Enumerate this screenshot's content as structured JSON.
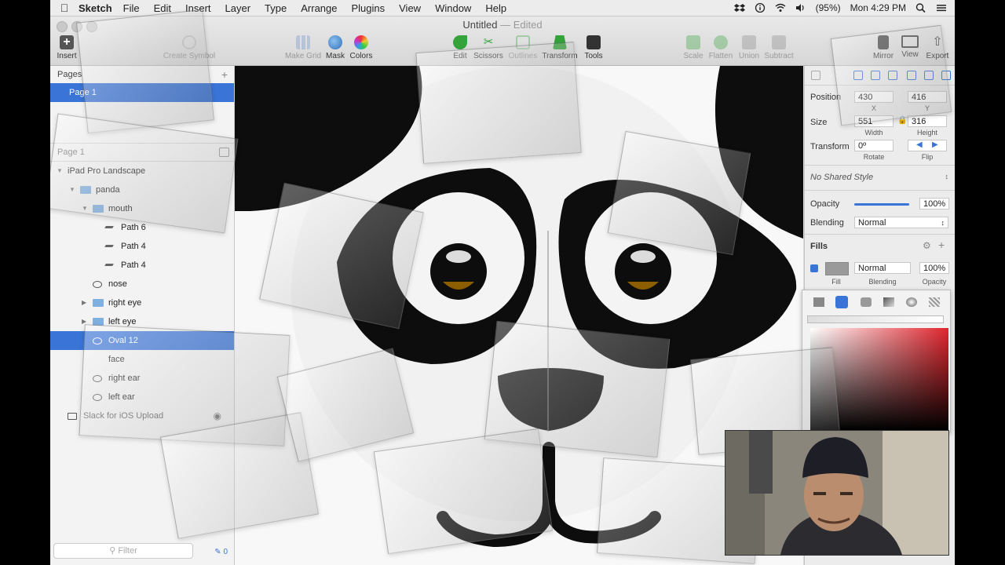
{
  "menubar": {
    "app_name": "Sketch",
    "menus": [
      "File",
      "Edit",
      "Insert",
      "Layer",
      "Type",
      "Arrange",
      "Plugins",
      "View",
      "Window",
      "Help"
    ],
    "battery": "(95%)",
    "clock": "Mon 4:29 PM"
  },
  "toolbar": {
    "document_title": "Untitled",
    "document_status": "— Edited",
    "buttons": [
      {
        "label": "Insert",
        "icon": "plus-icon",
        "color": "#555555"
      },
      {
        "label": "Create Symbol",
        "icon": "symbol-icon",
        "color": "#aaaaaa"
      },
      {
        "label": "Make Grid",
        "icon": "grid-icon",
        "color": "#6f8fc9"
      },
      {
        "label": "Mask",
        "icon": "mask-icon",
        "color": "#4a8bd4"
      },
      {
        "label": "Colors",
        "icon": "color-wheel-icon",
        "color": "#d14d8f"
      },
      {
        "label": "Edit",
        "icon": "edit-icon",
        "color": "#33a33a"
      },
      {
        "label": "Scissors",
        "icon": "scissors-icon",
        "color": "#33a33a"
      },
      {
        "label": "Outlines",
        "icon": "outlines-icon",
        "color": "#9bc79b"
      },
      {
        "label": "Transform",
        "icon": "transform-icon",
        "color": "#33a33a"
      },
      {
        "label": "Tools",
        "icon": "tools-icon",
        "color": "#333333"
      },
      {
        "label": "Scale",
        "icon": "scale-icon",
        "color": "#9bc79b"
      },
      {
        "label": "Flatten",
        "icon": "flatten-icon",
        "color": "#9bc79b"
      },
      {
        "label": "Union",
        "icon": "union-icon",
        "color": "#9bc79b"
      },
      {
        "label": "Subtract",
        "icon": "subtract-icon",
        "color": "#9bc79b"
      },
      {
        "label": "Mirror",
        "icon": "mirror-icon",
        "color": "#444444"
      },
      {
        "label": "View",
        "icon": "view-icon",
        "color": "#444444"
      },
      {
        "label": "Export",
        "icon": "export-icon",
        "color": "#444444"
      }
    ]
  },
  "pages_panel": {
    "header": "Pages",
    "add_symbol": "+",
    "pages": [
      "Page 1"
    ],
    "current_page_label": "Page 1"
  },
  "layers": [
    {
      "label": "iPad Pro Landscape",
      "kind": "artboard",
      "expanded": true
    },
    {
      "label": "panda",
      "kind": "folder",
      "expanded": true
    },
    {
      "label": "mouth",
      "kind": "folder",
      "expanded": true
    },
    {
      "label": "Path 6",
      "kind": "path"
    },
    {
      "label": "Path 4",
      "kind": "path"
    },
    {
      "label": "Path 4",
      "kind": "path"
    },
    {
      "label": "nose",
      "kind": "oval"
    },
    {
      "label": "right eye",
      "kind": "folder",
      "expanded": false
    },
    {
      "label": "left eye",
      "kind": "folder",
      "expanded": false
    },
    {
      "label": "Oval 12",
      "kind": "oval",
      "selected": true
    },
    {
      "label": "face",
      "kind": "shape"
    },
    {
      "label": "right ear",
      "kind": "oval"
    },
    {
      "label": "left ear",
      "kind": "oval"
    },
    {
      "label": "Slack for iOS Upload",
      "kind": "image"
    }
  ],
  "filter": {
    "placeholder": "Filter",
    "count": "0"
  },
  "inspector": {
    "position_label": "Position",
    "x": "430",
    "y": "416",
    "x_label": "X",
    "y_label": "Y",
    "size_label": "Size",
    "width": "551",
    "height": "316",
    "width_label": "Width",
    "height_label": "Height",
    "transform_label": "Transform",
    "rotate": "0º",
    "rotate_label": "Rotate",
    "flip_label": "Flip",
    "shared_style": "No Shared Style",
    "opacity_label": "Opacity",
    "opacity": "100%",
    "opacity_level": 1.0,
    "blending_label": "Blending",
    "blending": "Normal",
    "fills_label": "Fills",
    "fill_blending": "Normal",
    "fill_opacity": "100%",
    "fill_sub_fill": "Fill",
    "fill_sub_blending": "Blending",
    "fill_sub_opacity": "Opacity"
  },
  "colors": {
    "selection": "#3a74d6",
    "panda_black": "#0d0d0d",
    "pupil_highlight": "#8b5e00",
    "picker_red": "#e0262e"
  }
}
